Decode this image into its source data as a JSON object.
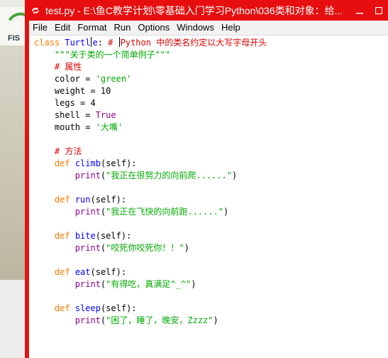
{
  "window": {
    "title": "test.py - E:\\鱼C教学计划\\零基础入门学习Python\\036类和对象：给..."
  },
  "background": {
    "logo_text": "FIS"
  },
  "menu": {
    "items": [
      "File",
      "Edit",
      "Format",
      "Run",
      "Options",
      "Windows",
      "Help"
    ]
  },
  "code": {
    "class_kw": "class",
    "class_name_a": " Turtl",
    "class_name_b": "e",
    "class_colon": ": ",
    "class_comment_a": "# ",
    "class_comment_b": "Python 中的类名约定以大写字母开头",
    "docstring": "\"\"\"关于类的一个简单例子\"\"\"",
    "attr_comment": "# 属性",
    "color_lhs": "color = ",
    "color_val": "'green'",
    "weight": "weight = 10",
    "legs": "legs = 4",
    "shell_lhs": "shell = ",
    "shell_val": "True",
    "mouth_lhs": "mouth = ",
    "mouth_val": "'大嘴'",
    "method_comment": "# 方法",
    "def_kw": "def",
    "print_kw": "print",
    "methods": [
      {
        "name": " climb",
        "sig": "(self):",
        "arg": "\"我正在很努力的向前爬......\"",
        "close": ")"
      },
      {
        "name": " run",
        "sig": "(self):",
        "arg": "\"我正在飞快的向前跑......\"",
        "close": ")"
      },
      {
        "name": " bite",
        "sig": "(self):",
        "arg": "\"咬死你咬死你！！\"",
        "close": ")"
      },
      {
        "name": " eat",
        "sig": "(self):",
        "arg": "\"有得吃，真满足^_^\"",
        "close": ")"
      },
      {
        "name": " sleep",
        "sig": "(self):",
        "arg": "\"困了，睡了，晚安，Zzzz\"",
        "close": ")"
      }
    ]
  },
  "colors": {
    "titlebar": "#e60e0e",
    "keyword": "#ff7700",
    "definition": "#0000ff",
    "string": "#00aa00",
    "comment": "#dd0000",
    "builtin": "#900090"
  },
  "icons": {
    "app": "python-idle-icon",
    "minimize": "minimize-icon",
    "maximize": "maximize-icon",
    "close": "close-icon"
  }
}
